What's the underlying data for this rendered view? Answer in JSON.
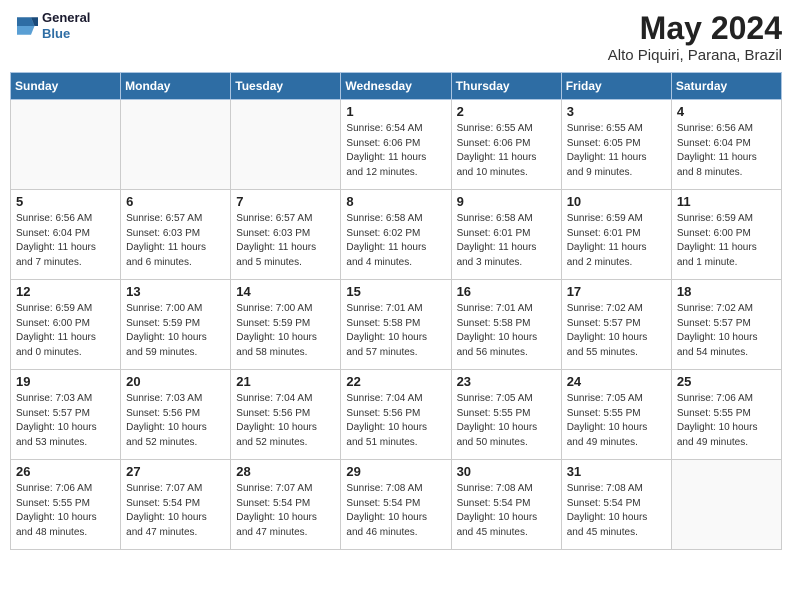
{
  "header": {
    "logo_line1": "General",
    "logo_line2": "Blue",
    "month": "May 2024",
    "location": "Alto Piquiri, Parana, Brazil"
  },
  "weekdays": [
    "Sunday",
    "Monday",
    "Tuesday",
    "Wednesday",
    "Thursday",
    "Friday",
    "Saturday"
  ],
  "weeks": [
    [
      {
        "day": "",
        "sunrise": "",
        "sunset": "",
        "daylight": ""
      },
      {
        "day": "",
        "sunrise": "",
        "sunset": "",
        "daylight": ""
      },
      {
        "day": "",
        "sunrise": "",
        "sunset": "",
        "daylight": ""
      },
      {
        "day": "1",
        "sunrise": "Sunrise: 6:54 AM",
        "sunset": "Sunset: 6:06 PM",
        "daylight": "Daylight: 11 hours and 12 minutes."
      },
      {
        "day": "2",
        "sunrise": "Sunrise: 6:55 AM",
        "sunset": "Sunset: 6:06 PM",
        "daylight": "Daylight: 11 hours and 10 minutes."
      },
      {
        "day": "3",
        "sunrise": "Sunrise: 6:55 AM",
        "sunset": "Sunset: 6:05 PM",
        "daylight": "Daylight: 11 hours and 9 minutes."
      },
      {
        "day": "4",
        "sunrise": "Sunrise: 6:56 AM",
        "sunset": "Sunset: 6:04 PM",
        "daylight": "Daylight: 11 hours and 8 minutes."
      }
    ],
    [
      {
        "day": "5",
        "sunrise": "Sunrise: 6:56 AM",
        "sunset": "Sunset: 6:04 PM",
        "daylight": "Daylight: 11 hours and 7 minutes."
      },
      {
        "day": "6",
        "sunrise": "Sunrise: 6:57 AM",
        "sunset": "Sunset: 6:03 PM",
        "daylight": "Daylight: 11 hours and 6 minutes."
      },
      {
        "day": "7",
        "sunrise": "Sunrise: 6:57 AM",
        "sunset": "Sunset: 6:03 PM",
        "daylight": "Daylight: 11 hours and 5 minutes."
      },
      {
        "day": "8",
        "sunrise": "Sunrise: 6:58 AM",
        "sunset": "Sunset: 6:02 PM",
        "daylight": "Daylight: 11 hours and 4 minutes."
      },
      {
        "day": "9",
        "sunrise": "Sunrise: 6:58 AM",
        "sunset": "Sunset: 6:01 PM",
        "daylight": "Daylight: 11 hours and 3 minutes."
      },
      {
        "day": "10",
        "sunrise": "Sunrise: 6:59 AM",
        "sunset": "Sunset: 6:01 PM",
        "daylight": "Daylight: 11 hours and 2 minutes."
      },
      {
        "day": "11",
        "sunrise": "Sunrise: 6:59 AM",
        "sunset": "Sunset: 6:00 PM",
        "daylight": "Daylight: 11 hours and 1 minute."
      }
    ],
    [
      {
        "day": "12",
        "sunrise": "Sunrise: 6:59 AM",
        "sunset": "Sunset: 6:00 PM",
        "daylight": "Daylight: 11 hours and 0 minutes."
      },
      {
        "day": "13",
        "sunrise": "Sunrise: 7:00 AM",
        "sunset": "Sunset: 5:59 PM",
        "daylight": "Daylight: 10 hours and 59 minutes."
      },
      {
        "day": "14",
        "sunrise": "Sunrise: 7:00 AM",
        "sunset": "Sunset: 5:59 PM",
        "daylight": "Daylight: 10 hours and 58 minutes."
      },
      {
        "day": "15",
        "sunrise": "Sunrise: 7:01 AM",
        "sunset": "Sunset: 5:58 PM",
        "daylight": "Daylight: 10 hours and 57 minutes."
      },
      {
        "day": "16",
        "sunrise": "Sunrise: 7:01 AM",
        "sunset": "Sunset: 5:58 PM",
        "daylight": "Daylight: 10 hours and 56 minutes."
      },
      {
        "day": "17",
        "sunrise": "Sunrise: 7:02 AM",
        "sunset": "Sunset: 5:57 PM",
        "daylight": "Daylight: 10 hours and 55 minutes."
      },
      {
        "day": "18",
        "sunrise": "Sunrise: 7:02 AM",
        "sunset": "Sunset: 5:57 PM",
        "daylight": "Daylight: 10 hours and 54 minutes."
      }
    ],
    [
      {
        "day": "19",
        "sunrise": "Sunrise: 7:03 AM",
        "sunset": "Sunset: 5:57 PM",
        "daylight": "Daylight: 10 hours and 53 minutes."
      },
      {
        "day": "20",
        "sunrise": "Sunrise: 7:03 AM",
        "sunset": "Sunset: 5:56 PM",
        "daylight": "Daylight: 10 hours and 52 minutes."
      },
      {
        "day": "21",
        "sunrise": "Sunrise: 7:04 AM",
        "sunset": "Sunset: 5:56 PM",
        "daylight": "Daylight: 10 hours and 52 minutes."
      },
      {
        "day": "22",
        "sunrise": "Sunrise: 7:04 AM",
        "sunset": "Sunset: 5:56 PM",
        "daylight": "Daylight: 10 hours and 51 minutes."
      },
      {
        "day": "23",
        "sunrise": "Sunrise: 7:05 AM",
        "sunset": "Sunset: 5:55 PM",
        "daylight": "Daylight: 10 hours and 50 minutes."
      },
      {
        "day": "24",
        "sunrise": "Sunrise: 7:05 AM",
        "sunset": "Sunset: 5:55 PM",
        "daylight": "Daylight: 10 hours and 49 minutes."
      },
      {
        "day": "25",
        "sunrise": "Sunrise: 7:06 AM",
        "sunset": "Sunset: 5:55 PM",
        "daylight": "Daylight: 10 hours and 49 minutes."
      }
    ],
    [
      {
        "day": "26",
        "sunrise": "Sunrise: 7:06 AM",
        "sunset": "Sunset: 5:55 PM",
        "daylight": "Daylight: 10 hours and 48 minutes."
      },
      {
        "day": "27",
        "sunrise": "Sunrise: 7:07 AM",
        "sunset": "Sunset: 5:54 PM",
        "daylight": "Daylight: 10 hours and 47 minutes."
      },
      {
        "day": "28",
        "sunrise": "Sunrise: 7:07 AM",
        "sunset": "Sunset: 5:54 PM",
        "daylight": "Daylight: 10 hours and 47 minutes."
      },
      {
        "day": "29",
        "sunrise": "Sunrise: 7:08 AM",
        "sunset": "Sunset: 5:54 PM",
        "daylight": "Daylight: 10 hours and 46 minutes."
      },
      {
        "day": "30",
        "sunrise": "Sunrise: 7:08 AM",
        "sunset": "Sunset: 5:54 PM",
        "daylight": "Daylight: 10 hours and 45 minutes."
      },
      {
        "day": "31",
        "sunrise": "Sunrise: 7:08 AM",
        "sunset": "Sunset: 5:54 PM",
        "daylight": "Daylight: 10 hours and 45 minutes."
      },
      {
        "day": "",
        "sunrise": "",
        "sunset": "",
        "daylight": ""
      }
    ]
  ]
}
